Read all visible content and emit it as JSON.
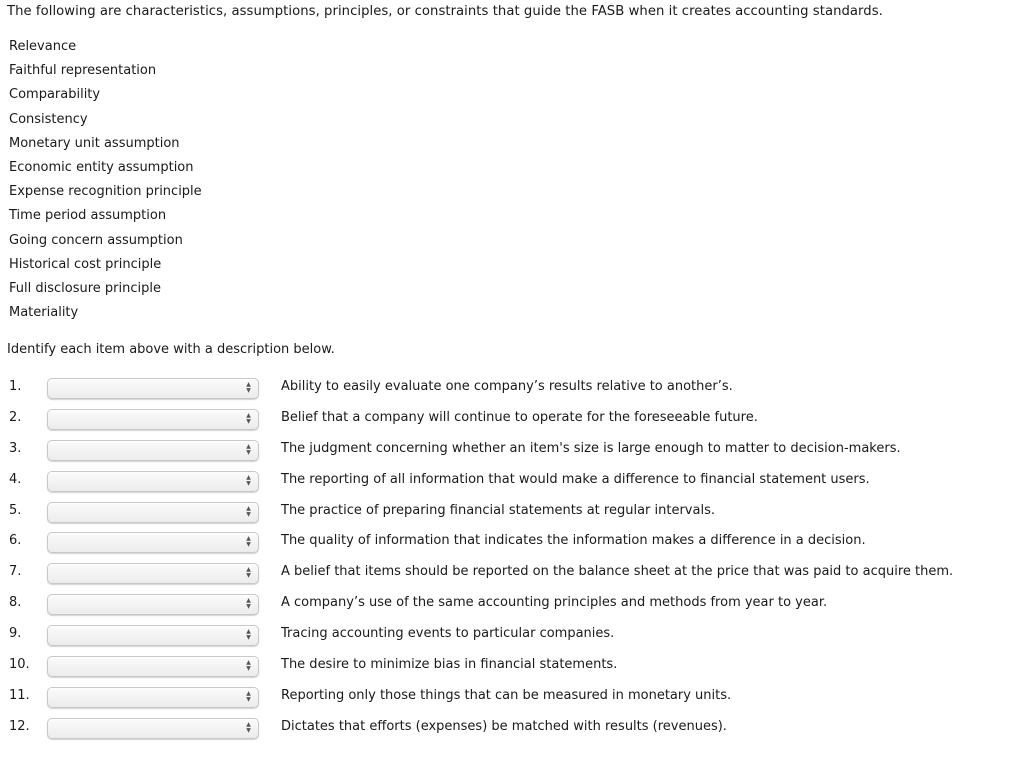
{
  "intro": "The following are characteristics, assumptions, principles, or constraints that guide the FASB when it creates accounting standards.",
  "terms": [
    "Relevance",
    "Faithful representation",
    "Comparability",
    "Consistency",
    "Monetary unit assumption",
    "Economic entity assumption",
    "Expense recognition principle",
    "Time period assumption",
    "Going concern assumption",
    "Historical cost principle",
    "Full disclosure principle",
    "Materiality"
  ],
  "instruction": "Identify each item above with a description below.",
  "select_arrow_icon": "up-down-arrows",
  "questions": [
    {
      "num": "1.",
      "selected": "",
      "desc": "Ability to easily evaluate one company’s results relative to another’s."
    },
    {
      "num": "2.",
      "selected": "",
      "desc": "Belief that a company will continue to operate for the foreseeable future."
    },
    {
      "num": "3.",
      "selected": "",
      "desc": "The judgment concerning whether an item's size is large enough to matter to decision-makers."
    },
    {
      "num": "4.",
      "selected": "",
      "desc": "The reporting of all information that would make a difference to financial statement users."
    },
    {
      "num": "5.",
      "selected": "",
      "desc": "The practice of preparing financial statements at regular intervals."
    },
    {
      "num": "6.",
      "selected": "",
      "desc": "The quality of information that indicates the information makes a difference in a decision."
    },
    {
      "num": "7.",
      "selected": "",
      "desc": "A belief that items should be reported on the balance sheet at the price that was paid to acquire them."
    },
    {
      "num": "8.",
      "selected": "",
      "desc": "A company’s use of the same accounting principles and methods from year to year."
    },
    {
      "num": "9.",
      "selected": "",
      "desc": "Tracing accounting events to particular companies."
    },
    {
      "num": "10.",
      "selected": "",
      "desc": "The desire to minimize bias in financial statements."
    },
    {
      "num": "11.",
      "selected": "",
      "desc": "Reporting only those things that can be measured in monetary units."
    },
    {
      "num": "12.",
      "selected": "",
      "desc": "Dictates that efforts (expenses) be matched with results (revenues)."
    }
  ]
}
